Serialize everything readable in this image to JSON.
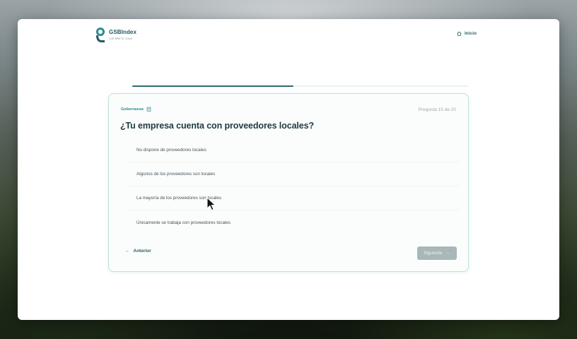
{
  "header": {
    "brand": "GSBIndex",
    "brand_sub": "con MW S. Cxxx",
    "home_label": "Inicio",
    "home_icon": "home-icon"
  },
  "progress": {
    "current": 15,
    "total": 20,
    "fraction": 0.48
  },
  "question": {
    "category": "Gobernanza",
    "category_icon": "building-icon",
    "counter": "Pregunta 15 de 20",
    "title": "¿Tu empresa cuenta con proveedores locales?",
    "options": [
      "No dispone de proveedores locales",
      "Algunos de los proveedores son locales",
      "La mayoría de los proveedores son locales",
      "Únicamente se trabaja con proveedores locales"
    ]
  },
  "footer": {
    "prev_label": "Anterior",
    "next_label": "Siguiente"
  },
  "colors": {
    "brand": "#1f5a5e",
    "accent": "#2f8a8e",
    "progress": "#2f6b72",
    "next_disabled": "#a9b7b8"
  }
}
